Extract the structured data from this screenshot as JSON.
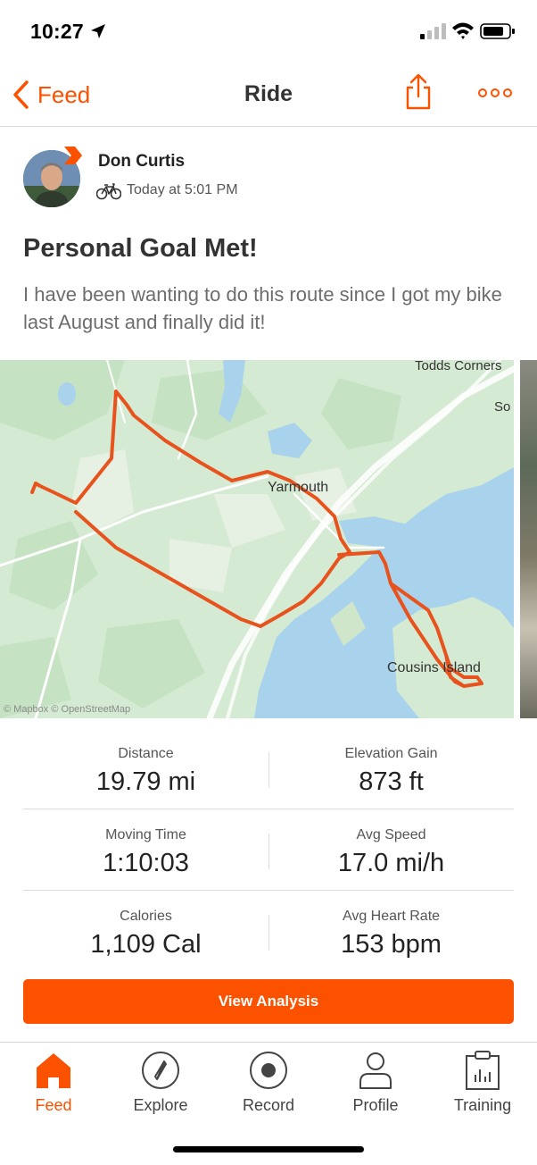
{
  "status_bar": {
    "time": "10:27"
  },
  "nav": {
    "back_label": "Feed",
    "title": "Ride"
  },
  "athlete": {
    "name": "Don Curtis",
    "activity_time": "Today at 5:01 PM"
  },
  "activity": {
    "title": "Personal Goal Met!",
    "description": "I have been wanting to do this route since I got my bike last August and finally did it!"
  },
  "map": {
    "labels": {
      "todds_corners": "Todds Corners",
      "yarmouth": "Yarmouth",
      "cousins_island": "Cousins Island",
      "so": "So"
    },
    "attribution": "© Mapbox © OpenStreetMap"
  },
  "stats": [
    {
      "label": "Distance",
      "value": "19.79 mi"
    },
    {
      "label": "Elevation Gain",
      "value": "873 ft"
    },
    {
      "label": "Moving Time",
      "value": "1:10:03"
    },
    {
      "label": "Avg Speed",
      "value": "17.0 mi/h"
    },
    {
      "label": "Calories",
      "value": "1,109 Cal"
    },
    {
      "label": "Avg Heart Rate",
      "value": "153 bpm"
    }
  ],
  "buttons": {
    "view_analysis": "View Analysis"
  },
  "tabs": [
    {
      "label": "Feed",
      "icon": "home-icon"
    },
    {
      "label": "Explore",
      "icon": "compass-icon"
    },
    {
      "label": "Record",
      "icon": "record-icon"
    },
    {
      "label": "Profile",
      "icon": "profile-icon"
    },
    {
      "label": "Training",
      "icon": "clipboard-chart-icon"
    }
  ],
  "colors": {
    "accent": "#fc5200",
    "route": "#e8531d",
    "water": "#a9d3ec",
    "land": "#d4ead2"
  }
}
